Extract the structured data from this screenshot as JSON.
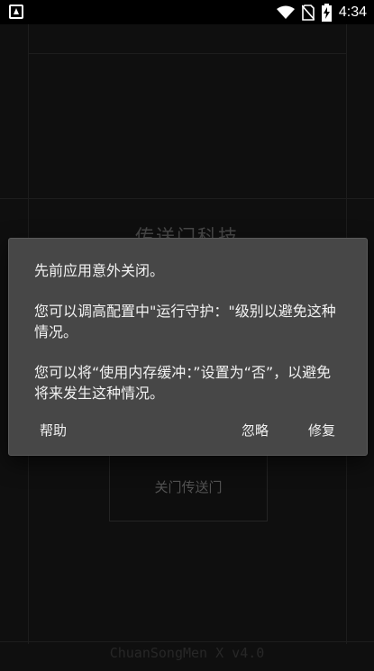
{
  "status_bar": {
    "time": "4:34",
    "icons": [
      "app-notification-icon",
      "wifi-icon",
      "no-sim-icon",
      "battery-charging-icon"
    ]
  },
  "background_app": {
    "title": "传送门科技",
    "button_label": "关门传送门",
    "footer": "ChuanSongMen X v4.0"
  },
  "dialog": {
    "paragraphs": [
      "先前应用意外关闭。",
      "您可以调高配置中\"运行守护：\"级别以避免这种情况。",
      "您可以将“使用内存缓冲：”设置为“否”，以避免将来发生这种情况。"
    ],
    "buttons": {
      "help": "帮助",
      "ignore": "忽略",
      "repair": "修复"
    }
  }
}
